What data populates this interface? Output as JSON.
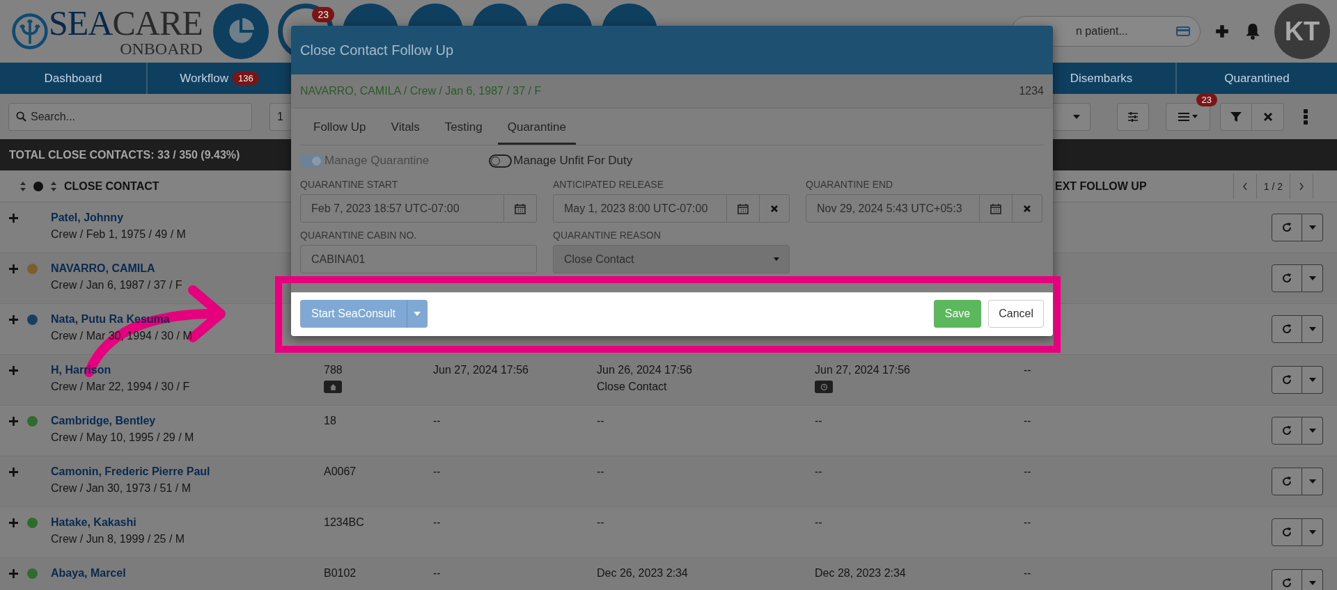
{
  "header": {
    "logo_main": "SEA",
    "logo_rest": "CARE",
    "logo_sub": "ONBOARD",
    "nav_badge": "23",
    "search_placeholder": "n patient...",
    "user_initials": "KT"
  },
  "nav_tabs": [
    {
      "label": "Dashboard"
    },
    {
      "label": "Workflow",
      "badge": "136"
    },
    {
      "label": "Disembarks"
    },
    {
      "label": "Quarantined"
    }
  ],
  "toolbar": {
    "search_placeholder": "Search...",
    "page_size": "1",
    "view_badge": "23"
  },
  "summary": "TOTAL CLOSE CONTACTS: 33 / 350 (9.43%)",
  "table": {
    "columns": [
      {
        "label": "CLOSE CONTACT"
      },
      {
        "label": "EXT FOLLOW UP"
      }
    ],
    "pager": "1 / 2",
    "rows": [
      {
        "name": "Patel, Johnny",
        "details": "Crew / Feb 1, 1975 / 49 / M",
        "cells": []
      },
      {
        "name": "NAVARRO, CAMILA",
        "details": "Crew / Jan 6, 1987 / 37 / F",
        "color": "#7d5f2c",
        "cells": []
      },
      {
        "name": "Nata, Putu Ra Kesuma",
        "details": "Crew / Mar 30, 1994 / 30 / M",
        "color": "#163f63",
        "cells": []
      },
      {
        "name": "H, Harrison",
        "details": "Crew / Mar 22, 1994 / 30 / F",
        "cells": [
          {
            "text": "788",
            "kind": "home"
          },
          {
            "text": "Jun 27, 2024 17:56",
            "kind": "plain"
          },
          {
            "text": "Jun 26, 2024 17:56",
            "note": "Close Contact",
            "kind": "plain"
          },
          {
            "text": "Jun 27, 2024 17:56",
            "kind": "clock"
          },
          {
            "text": "--",
            "kind": "plain"
          }
        ]
      },
      {
        "name": "Cambridge, Bentley",
        "details": "Crew / May 10, 1995 / 29 / M",
        "color": "#2f6a2f",
        "cells": [
          {
            "text": "18"
          },
          {
            "text": "--"
          },
          {
            "text": "--"
          },
          {
            "text": "--"
          },
          {
            "text": "--"
          }
        ]
      },
      {
        "name": "Camonin, Frederic Pierre Paul",
        "details": "Crew / Jan 30, 1973 / 51 / M",
        "cells": [
          {
            "text": "A0067"
          },
          {
            "text": "--"
          },
          {
            "text": "--"
          },
          {
            "text": "--"
          },
          {
            "text": "--"
          }
        ]
      },
      {
        "name": "Hatake, Kakashi",
        "details": "Crew / Jun 8, 1999 / 25 / M",
        "color": "#2f6a2f",
        "cells": [
          {
            "text": "1234BC"
          },
          {
            "text": "--"
          },
          {
            "text": "--"
          },
          {
            "text": "--"
          },
          {
            "text": "--"
          }
        ]
      },
      {
        "name": "Abaya, Marcel",
        "color": "#2f6a2f",
        "cells": [
          {
            "text": "B0102"
          },
          {
            "text": "--"
          },
          {
            "text": "Dec 26, 2023 2:34"
          },
          {
            "text": "Dec 28, 2023 2:34"
          },
          {
            "text": "--"
          }
        ]
      }
    ]
  },
  "modal": {
    "title": "Close Contact Follow Up",
    "patient": "NAVARRO, CAMILA / Crew / Jan 6, 1987 / 37 / F",
    "patient_id": "1234",
    "tabs": [
      {
        "label": "Follow Up",
        "selected": false
      },
      {
        "label": "Vitals",
        "selected": false
      },
      {
        "label": "Testing",
        "selected": false
      },
      {
        "label": "Quarantine",
        "selected": true
      }
    ],
    "toggles": [
      {
        "label": "Manage Quarantine",
        "on": true,
        "disabled": true
      },
      {
        "label": "Manage Unfit For Duty",
        "on": false,
        "disabled": false
      }
    ],
    "fields": [
      {
        "label": "QUARANTINE START",
        "value": "Feb 7, 2023 18:57 UTC-07:00",
        "kind": "date",
        "clearable": false
      },
      {
        "label": "ANTICIPATED RELEASE",
        "value": "May 1, 2023 8:00 UTC-07:00",
        "kind": "date",
        "clearable": true
      },
      {
        "label": "QUARANTINE END",
        "value": "Nov 29, 2024 5:43 UTC+05:3",
        "kind": "date",
        "clearable": true
      },
      {
        "label": "QUARANTINE CABIN NO.",
        "value": "CABINA01",
        "kind": "text"
      },
      {
        "label": "QUARANTINE REASON",
        "value": "Close Contact",
        "kind": "select"
      }
    ],
    "footer": {
      "consult": "Start SeaConsult",
      "save": "Save",
      "cancel": "Cancel"
    }
  }
}
